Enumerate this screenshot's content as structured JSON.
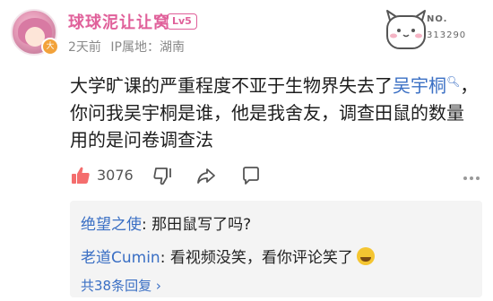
{
  "post": {
    "username": "球球泥让让窝",
    "level": "Lv5",
    "time": "2天前",
    "ip_location": "IP属地：湖南",
    "decor_no": "NO.",
    "decor_number": "313290",
    "content_part1": "大学旷课的严重程度不亚于生物界失去了",
    "mention": "吴宇桐",
    "content_part2": "，你问我吴宇桐是谁，他是我舍友，调查田鼠的数量用的是问卷调查法",
    "like_count": "3076"
  },
  "replies": [
    {
      "author": "绝望之使",
      "text": "那田鼠写了吗?"
    },
    {
      "author": "老道Cumin",
      "text": "看视频没笑，看你评论笑了"
    }
  ],
  "more_replies": "共38条回复 ›",
  "icons": {
    "like": "thumbs-up-icon",
    "dislike": "thumbs-down-icon",
    "share": "share-icon",
    "comment": "comment-icon",
    "more": "more-icon",
    "search": "search-icon"
  },
  "colors": {
    "username": "#e0609a",
    "link": "#3a6fc4",
    "like": "#f46d6d",
    "reply_bg": "#f4f4f4"
  }
}
